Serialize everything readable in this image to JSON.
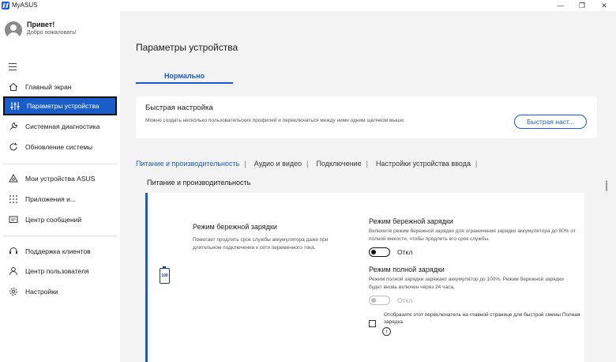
{
  "window": {
    "title": "MyASUS",
    "minimize": "—",
    "restore": "❐",
    "close": "✕"
  },
  "user": {
    "greeting": "Привет!",
    "welcome": "Добро пожаловать!"
  },
  "sidebar": {
    "items": [
      {
        "label": "Главный экран",
        "icon": "home-icon"
      },
      {
        "label": "Параметры устройства",
        "icon": "sliders-icon",
        "active": true
      },
      {
        "label": "Системная диагностика",
        "icon": "wrench-icon"
      },
      {
        "label": "Обновление системы",
        "icon": "refresh-icon"
      },
      {
        "label": "Мои устройства ASUS",
        "icon": "devices-icon"
      },
      {
        "label": "Приложения и...",
        "icon": "apps-grid-icon"
      },
      {
        "label": "Центр сообщений",
        "icon": "message-icon"
      },
      {
        "label": "Поддержка клиентов",
        "icon": "support-icon"
      },
      {
        "label": "Центр пользователя",
        "icon": "user-icon"
      },
      {
        "label": "Настройки",
        "icon": "gear-icon"
      }
    ]
  },
  "main": {
    "page_title": "Параметры устройства",
    "mode_tab": "Нормально",
    "quick": {
      "title": "Быстрая настройка",
      "description": "Можно создать несколько пользовательских профилей и переключаться между ними одним щелчком мыши.",
      "button": "Быстрая наст..."
    },
    "subtabs": [
      {
        "label": "Питание и производительность",
        "active": true
      },
      {
        "label": "Аудио и видео"
      },
      {
        "label": "Подключение"
      },
      {
        "label": "Настройки устройства ввода"
      }
    ],
    "separator": "|",
    "section_title": "Питание и производительность",
    "battery_icon_text": "100",
    "care_mode": {
      "title": "Режим бережной зарядки",
      "description": "Помогает продлить срок службы аккумулятора даже при длительном подключении к сети переменного тока.",
      "option_title": "Режим бережной зарядки",
      "option_desc": "Включите режим бережной зарядки для ограничения зарядки аккумулятора до 80% от полной емкости, чтобы продлить его срок службы.",
      "toggle_state": "Откл"
    },
    "full_mode": {
      "title": "Режим полной зарядки",
      "description": "Режим полной зарядки заряжает аккумулятор до 100%. Режим бережной зарядки будет вновь включен через 24 часа.",
      "toggle_state": "Откл"
    },
    "checkbox_text": "Отобразите этот переключатель на главной странице для быстрой смены Полная зарядка.",
    "info_glyph": "i"
  }
}
